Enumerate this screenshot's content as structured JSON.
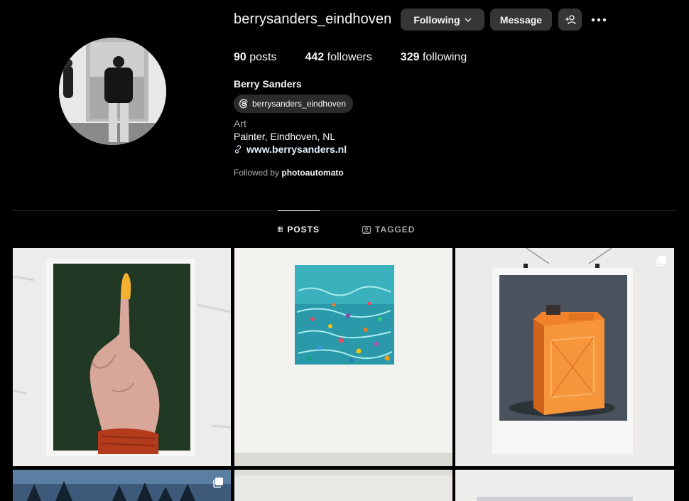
{
  "profile": {
    "username": "berrysanders_eindhoven",
    "full_name": "Berry Sanders",
    "threads_handle": "berrysanders_eindhoven",
    "category": "Art",
    "bio": "Painter, Eindhoven, NL",
    "website": "www.berrysanders.nl",
    "followed_by_prefix": "Followed by",
    "followed_by_user": "photoautomato"
  },
  "actions": {
    "following_label": "Following",
    "message_label": "Message"
  },
  "stats": {
    "posts_count": "90",
    "posts_label": "posts",
    "followers_count": "442",
    "followers_label": "followers",
    "following_count": "329",
    "following_label": "following"
  },
  "tabs": {
    "posts": "POSTS",
    "tagged": "TAGGED"
  },
  "posts": [
    {
      "subject": "painting-hand"
    },
    {
      "subject": "painting-water"
    },
    {
      "subject": "painting-jerrycan",
      "multi": true
    },
    {
      "subject": "photo-trees",
      "multi": true
    },
    {
      "subject": "photo-white"
    },
    {
      "subject": "photo-white-2"
    }
  ],
  "colors": {
    "background": "#000000",
    "button": "#363636",
    "muted_text": "#a8a8a8",
    "divider": "#262626"
  }
}
